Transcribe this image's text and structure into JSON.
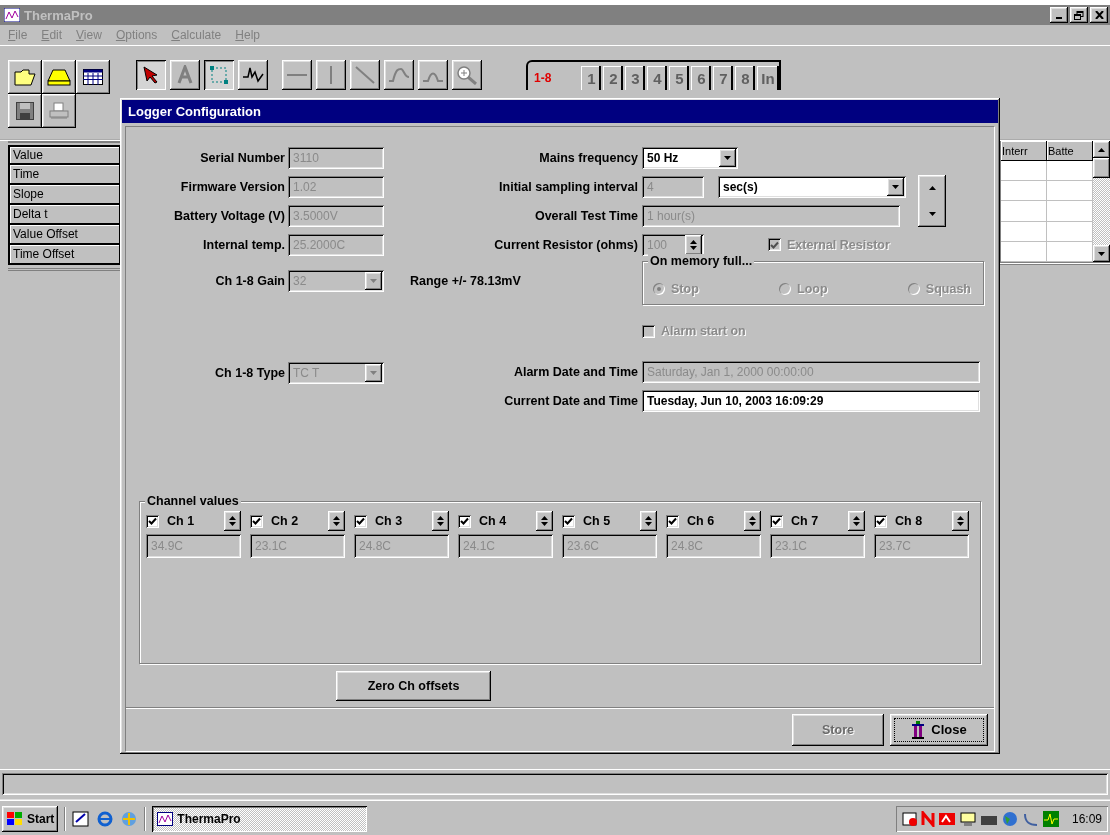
{
  "window": {
    "title": "ThermaPro"
  },
  "menu": [
    "File",
    "Edit",
    "View",
    "Options",
    "Calculate",
    "Help"
  ],
  "toolbar": {
    "tools": [
      {
        "kind": "pointer",
        "pressed": true
      },
      {
        "kind": "text",
        "pressed": false
      },
      {
        "kind": "select",
        "pressed": true
      },
      {
        "kind": "trace",
        "pressed": false
      },
      {
        "kind": "hline",
        "pressed": false
      },
      {
        "kind": "vline",
        "pressed": false
      },
      {
        "kind": "diagonal",
        "pressed": false
      },
      {
        "kind": "curve",
        "pressed": false
      },
      {
        "kind": "peak",
        "pressed": false
      },
      {
        "kind": "zoom",
        "pressed": false
      }
    ]
  },
  "channel_tabs": [
    {
      "label": "1-8",
      "selected": true
    },
    {
      "label": "1",
      "selected": false
    },
    {
      "label": "2",
      "selected": false
    },
    {
      "label": "3",
      "selected": false
    },
    {
      "label": "4",
      "selected": false
    },
    {
      "label": "5",
      "selected": false
    },
    {
      "label": "6",
      "selected": false
    },
    {
      "label": "7",
      "selected": false
    },
    {
      "label": "8",
      "selected": false
    },
    {
      "label": "In",
      "selected": false
    }
  ],
  "side_list": [
    "Value",
    "Time",
    "Slope",
    "Delta t",
    "Value Offset",
    "Time Offset"
  ],
  "grid": {
    "columns": [
      "Interr",
      "Batte"
    ]
  },
  "dialog": {
    "title": "Logger Configuration",
    "info_fields": [
      {
        "label": "Serial Number",
        "value": "3110",
        "disabled": true
      },
      {
        "label": "Firmware Version",
        "value": "1.02",
        "disabled": true
      },
      {
        "label": "Battery Voltage (V)",
        "value": "3.5000V",
        "disabled": true
      },
      {
        "label": "Internal temp.",
        "value": "25.2000C",
        "disabled": true
      }
    ],
    "gain": {
      "label": "Ch 1-8 Gain",
      "value": "32",
      "disabled": true
    },
    "range": "Range +/- 78.13mV",
    "type": {
      "label": "Ch 1-8 Type",
      "value": "TC T",
      "disabled": true
    },
    "mains": {
      "label": "Mains frequency",
      "value": "50 Hz",
      "disabled": false
    },
    "sampling": {
      "label": "Initial sampling interval",
      "value": "4",
      "disabled": true,
      "unit": "sec(s)",
      "unit_disabled": false
    },
    "overall": {
      "label": "Overall Test Time",
      "value": "1 hour(s)",
      "disabled": true
    },
    "resistor": {
      "label": "Current Resistor (ohms)",
      "value": "100",
      "disabled": true
    },
    "external_resistor": {
      "label": "External Resistor",
      "checked": true,
      "disabled": true
    },
    "memory": {
      "legend": "On memory full...",
      "disabled": true,
      "options": [
        {
          "label": "Stop",
          "selected": true
        },
        {
          "label": "Loop",
          "selected": false
        },
        {
          "label": "Squash",
          "selected": false
        }
      ]
    },
    "alarm_start": {
      "label": "Alarm start on",
      "checked": false,
      "disabled": true
    },
    "alarm_date": {
      "label": "Alarm Date and Time",
      "value": "Saturday, Jan 1, 2000 00:00:00",
      "disabled": true
    },
    "current_date": {
      "label": "Current Date and Time",
      "value": "Tuesday, Jun 10, 2003 16:09:29",
      "disabled": false
    },
    "channels": {
      "legend": "Channel values",
      "items": [
        {
          "label": "Ch 1",
          "checked": true,
          "value": "34.9C"
        },
        {
          "label": "Ch 2",
          "checked": true,
          "value": "23.1C"
        },
        {
          "label": "Ch 3",
          "checked": true,
          "value": "24.8C"
        },
        {
          "label": "Ch 4",
          "checked": true,
          "value": "24.1C"
        },
        {
          "label": "Ch 5",
          "checked": true,
          "value": "23.6C"
        },
        {
          "label": "Ch 6",
          "checked": true,
          "value": "24.8C"
        },
        {
          "label": "Ch 7",
          "checked": true,
          "value": "23.1C"
        },
        {
          "label": "Ch 8",
          "checked": true,
          "value": "23.7C"
        }
      ]
    },
    "zero_button": {
      "label": "Zero Ch offsets"
    },
    "store_button": {
      "label": "Store",
      "disabled": true
    },
    "close_button": {
      "label": "Close",
      "disabled": false
    }
  },
  "taskbar": {
    "start": "Start",
    "tasks": [
      {
        "label": "ThermaPro"
      }
    ],
    "clock": "16:09"
  }
}
